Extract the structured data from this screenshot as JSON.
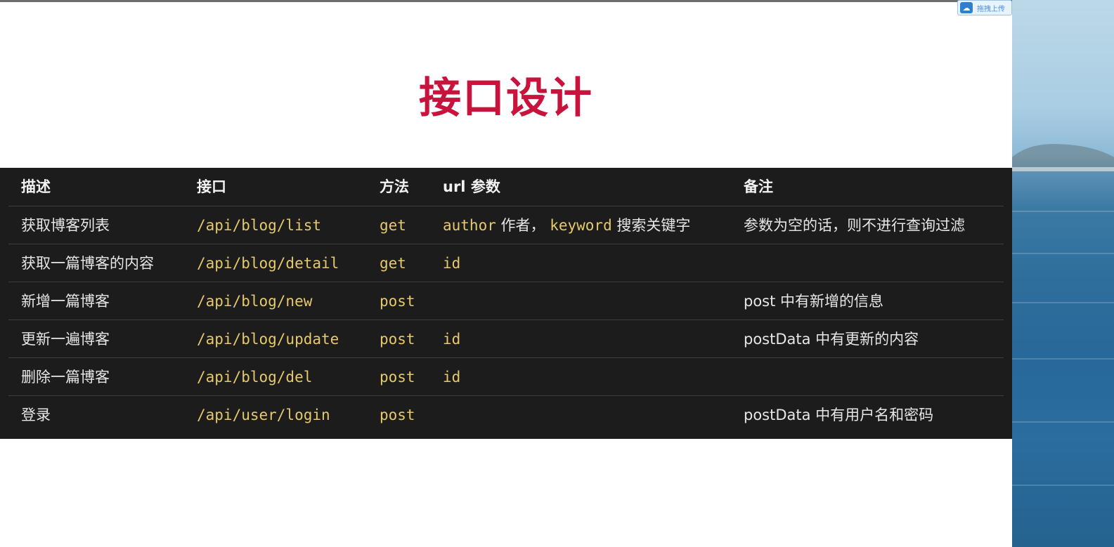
{
  "upload_badge": {
    "label": "拖拽上传",
    "icon": "cloud-icon"
  },
  "title": "接口设计",
  "table": {
    "headers": [
      "描述",
      "接口",
      "方法",
      "url 参数",
      "备注"
    ],
    "rows": [
      {
        "desc": "获取博客列表",
        "api": "/api/blog/list",
        "method": "get",
        "params": {
          "code1": "author",
          "txt1": " 作者， ",
          "code2": "keyword",
          "txt2": " 搜索关键字"
        },
        "note": "参数为空的话，则不进行查询过滤"
      },
      {
        "desc": "获取一篇博客的内容",
        "api": "/api/blog/detail",
        "method": "get",
        "params": {
          "code1": "id"
        },
        "note": ""
      },
      {
        "desc": "新增一篇博客",
        "api": "/api/blog/new",
        "method": "post",
        "params": {},
        "note": "post 中有新增的信息"
      },
      {
        "desc": "更新一遍博客",
        "api": "/api/blog/update",
        "method": "post",
        "params": {
          "code1": "id"
        },
        "note": "postData 中有更新的内容"
      },
      {
        "desc": "删除一篇博客",
        "api": "/api/blog/del",
        "method": "post",
        "params": {
          "code1": "id"
        },
        "note": ""
      },
      {
        "desc": "登录",
        "api": "/api/user/login",
        "method": "post",
        "params": {},
        "note": "postData 中有用户名和密码"
      }
    ]
  },
  "colors": {
    "title": "#c8133d",
    "table_bg": "#1c1c1c",
    "code_text": "#e6c96a",
    "body_text": "#e6e6e6"
  }
}
